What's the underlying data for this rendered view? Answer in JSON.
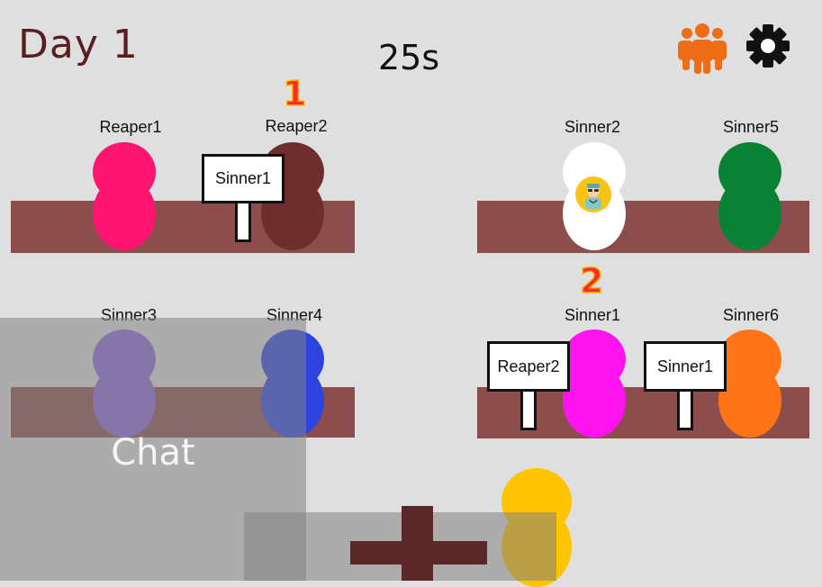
{
  "hud": {
    "day": "Day 1",
    "timer": "25s",
    "players_icon": "people-group-icon",
    "settings_icon": "gear-icon",
    "accent_color": "#ef6d16"
  },
  "tables": [
    {
      "players": [
        {
          "name": "Reaper1",
          "color": "#ff1470"
        },
        {
          "name": "Reaper2",
          "color": "#6e2e2e"
        }
      ],
      "vote_count": "1",
      "signs": [
        {
          "text": "Sinner1"
        }
      ]
    },
    {
      "players": [
        {
          "name": "Sinner2",
          "color": "#ffffff",
          "badge": "doctor-icon"
        },
        {
          "name": "Sinner5",
          "color": "#098235"
        }
      ]
    },
    {
      "players": [
        {
          "name": "Sinner3",
          "color": "#8c66d9"
        },
        {
          "name": "Sinner4",
          "color": "#2d44e0"
        }
      ]
    },
    {
      "players": [
        {
          "name": "Sinner1",
          "color": "#ff14f0"
        },
        {
          "name": "Sinner6",
          "color": "#ff7416"
        }
      ],
      "vote_count": "2",
      "signs": [
        {
          "text": "Reaper2"
        },
        {
          "text": "Sinner1"
        }
      ]
    }
  ],
  "self_player": {
    "color": "#ffc400"
  },
  "chat": {
    "label": "Chat"
  },
  "controls": {
    "add_icon": "plus-icon",
    "add_color": "#5a2828"
  }
}
